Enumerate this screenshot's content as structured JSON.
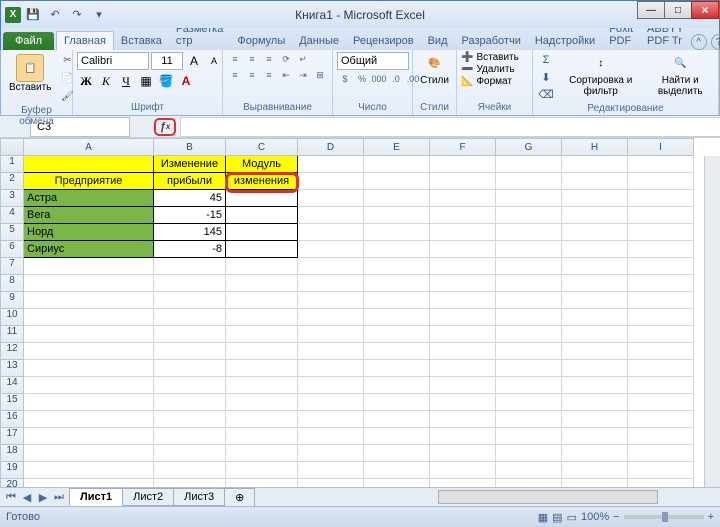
{
  "title": "Книга1 - Microsoft Excel",
  "qat": {
    "save": "💾",
    "undo": "↶",
    "redo": "↷"
  },
  "tabs": {
    "file": "Файл",
    "home": "Главная",
    "insert": "Вставка",
    "pagelayout": "Разметка стр",
    "formulas": "Формулы",
    "data": "Данные",
    "review": "Рецензиров",
    "view": "Вид",
    "developer": "Разработчи",
    "addins": "Надстройки",
    "foxit": "Foxit PDF",
    "abbyy": "ABBYY PDF Tr"
  },
  "ribbon": {
    "clipboard": {
      "paste": "Вставить",
      "label": "Буфер обмена"
    },
    "font": {
      "name": "Calibri",
      "size": "11",
      "label": "Шрифт"
    },
    "align": {
      "wrap": "Перенос",
      "label": "Выравнивание"
    },
    "number": {
      "fmt": "Общий",
      "label": "Число"
    },
    "styles": {
      "btn": "Стили",
      "label": "Стили"
    },
    "cells": {
      "insert": "Вставить",
      "delete": "Удалить",
      "format": "Формат",
      "label": "Ячейки"
    },
    "editing": {
      "sort": "Сортировка и фильтр",
      "find": "Найти и выделить",
      "label": "Редактирование"
    }
  },
  "namebox": "C3",
  "cols": [
    "A",
    "B",
    "C",
    "D",
    "E",
    "F",
    "G",
    "H",
    "I"
  ],
  "table": {
    "h1": "Предприятие",
    "h2": "Изменение прибыли",
    "h3": "Модуль изменения",
    "rows": [
      {
        "name": "Астра",
        "val": "45"
      },
      {
        "name": "Вега",
        "val": "-15"
      },
      {
        "name": "Норд",
        "val": "145"
      },
      {
        "name": "Сириус",
        "val": "-8"
      }
    ]
  },
  "sheets": {
    "s1": "Лист1",
    "s2": "Лист2",
    "s3": "Лист3"
  },
  "status": {
    "ready": "Готово",
    "zoom": "100%"
  }
}
